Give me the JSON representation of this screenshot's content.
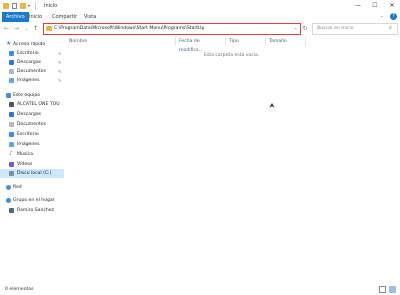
{
  "window": {
    "title": "Inicio",
    "controls": {
      "minimize": "—",
      "maximize": "☐",
      "close": "✕"
    }
  },
  "ribbon": {
    "tabs": [
      {
        "label": "Archivo",
        "active": true
      },
      {
        "label": "Inicio",
        "active": false
      },
      {
        "label": "Compartir",
        "active": false
      },
      {
        "label": "Vista",
        "active": false
      }
    ],
    "help_icon": "?"
  },
  "nav_buttons": {
    "back": "←",
    "forward": "→",
    "recent": "⌄",
    "up": "↑"
  },
  "address": {
    "path": "C:\\ProgramData\\Microsoft\\Windows\\Start Menu\\Programs\\StartUp",
    "refresh": "↻"
  },
  "search": {
    "placeholder": "Buscar en Inicio"
  },
  "sidebar": {
    "sections": [
      {
        "header": "Acceso rápido",
        "icon": "star-icon",
        "items": [
          {
            "label": "Escritorio",
            "icon": "desktop-icon",
            "color": "#3b8ee6",
            "pinned": true
          },
          {
            "label": "Descargas",
            "icon": "download-icon",
            "color": "#2f76d2",
            "pinned": true
          },
          {
            "label": "Documentos",
            "icon": "documents-icon",
            "color": "#b0b8c4",
            "pinned": true
          },
          {
            "label": "Imágenes",
            "icon": "pictures-icon",
            "color": "#5aa9e6",
            "pinned": true
          }
        ]
      },
      {
        "header": "Este equipo",
        "icon": "computer-icon",
        "items": [
          {
            "label": "ALCATEL ONE TOU",
            "icon": "phone-icon",
            "color": "#555555"
          },
          {
            "label": "Descargas",
            "icon": "download-icon",
            "color": "#2f76d2"
          },
          {
            "label": "Documentos",
            "icon": "documents-icon",
            "color": "#b0b8c4"
          },
          {
            "label": "Escritorio",
            "icon": "desktop-icon",
            "color": "#3b8ee6"
          },
          {
            "label": "Imágenes",
            "icon": "pictures-icon",
            "color": "#5aa9e6"
          },
          {
            "label": "Música",
            "icon": "music-icon",
            "color": "#3b8ee6"
          },
          {
            "label": "Vídeos",
            "icon": "videos-icon",
            "color": "#7a5ac8"
          },
          {
            "label": "Disco local (C:)",
            "icon": "drive-icon",
            "color": "#7d8fa3",
            "selected": true
          }
        ]
      },
      {
        "header": "Red",
        "icon": "network-icon",
        "items": []
      },
      {
        "header": "Grupo en el hogar",
        "icon": "homegroup-icon",
        "items": [
          {
            "label": "Ramiro Sanchez",
            "icon": "user-icon",
            "color": "#4a6a8a"
          }
        ]
      }
    ],
    "pin_glyph": "✎"
  },
  "columns": [
    "Nombre",
    "Fecha de modifica...",
    "Tipo",
    "Tamaño"
  ],
  "empty_message": "Esta carpeta está vacía.",
  "status": {
    "items_text": "0 elementos"
  },
  "colors": {
    "accent": "#1979ca",
    "selection": "#cce8ff",
    "folder": "#e8b547",
    "address_border": "#e04040"
  }
}
